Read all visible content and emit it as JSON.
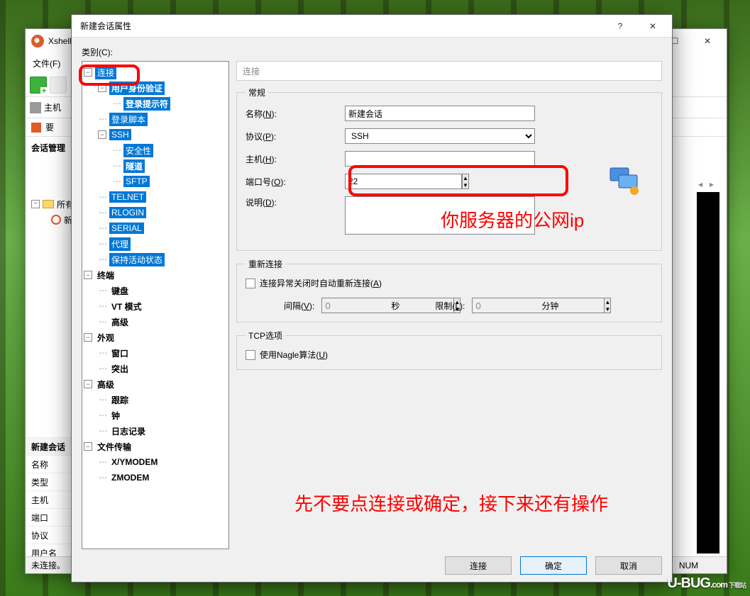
{
  "parent": {
    "title": "Xshell",
    "menu_file": "文件(F)",
    "address_label": "主机",
    "session_flag": "要",
    "session_mgr": "会话管理",
    "tree_root": "所有",
    "tree_session": "新",
    "props_header": "新建会话",
    "props": {
      "name": "名称",
      "type": "类型",
      "host": "主机",
      "port": "端口",
      "protocol": "协议",
      "user": "用户名"
    },
    "status_left": "未连接。",
    "status_right": "NUM"
  },
  "dialog": {
    "title": "新建会话属性",
    "category_label": "类别(C):",
    "tree": {
      "connection": "连接",
      "auth": "用户身份验证",
      "login_prompt": "登录提示符",
      "login_script": "登录脚本",
      "ssh": "SSH",
      "security": "安全性",
      "tunnel": "隧道",
      "sftp": "SFTP",
      "telnet": "TELNET",
      "rlogin": "RLOGIN",
      "serial": "SERIAL",
      "proxy": "代理",
      "keepalive": "保持活动状态",
      "terminal": "终端",
      "keyboard": "键盘",
      "vt": "VT 模式",
      "advanced": "高级",
      "appearance": "外观",
      "window": "窗口",
      "highlight": "突出",
      "advanced2": "高级",
      "trace": "跟踪",
      "bell": "钟",
      "logging": "日志记录",
      "file_transfer": "文件传输",
      "xymodem": "X/YMODEM",
      "zmodem": "ZMODEM"
    },
    "pane_title": "连接",
    "general": {
      "legend": "常规",
      "name_label": "名称(N):",
      "name_value": "新建会话",
      "protocol_label": "协议(P):",
      "protocol_value": "SSH",
      "host_label": "主机(H):",
      "host_value": "",
      "port_label": "端口号(O):",
      "port_value": "22",
      "desc_label": "说明(D):",
      "desc_value": ""
    },
    "reconnect": {
      "legend": "重新连接",
      "auto_label": "连接异常关闭时自动重新连接(A)",
      "interval_label": "间隔(V):",
      "interval_value": "0",
      "interval_unit": "秒",
      "limit_label": "限制(L):",
      "limit_value": "0",
      "limit_unit": "分钟"
    },
    "tcp": {
      "legend": "TCP选项",
      "nagle_label": "使用Nagle算法(U)"
    },
    "btn_connect": "连接",
    "btn_ok": "确定",
    "btn_cancel": "取消"
  },
  "annotations": {
    "ip_hint": "你服务器的公网ip",
    "bottom_hint": "先不要点连接或确定，接下来还有操作"
  },
  "badge": {
    "brand": "U-BUG",
    "suffix": ".com",
    "sub": "下载站"
  }
}
